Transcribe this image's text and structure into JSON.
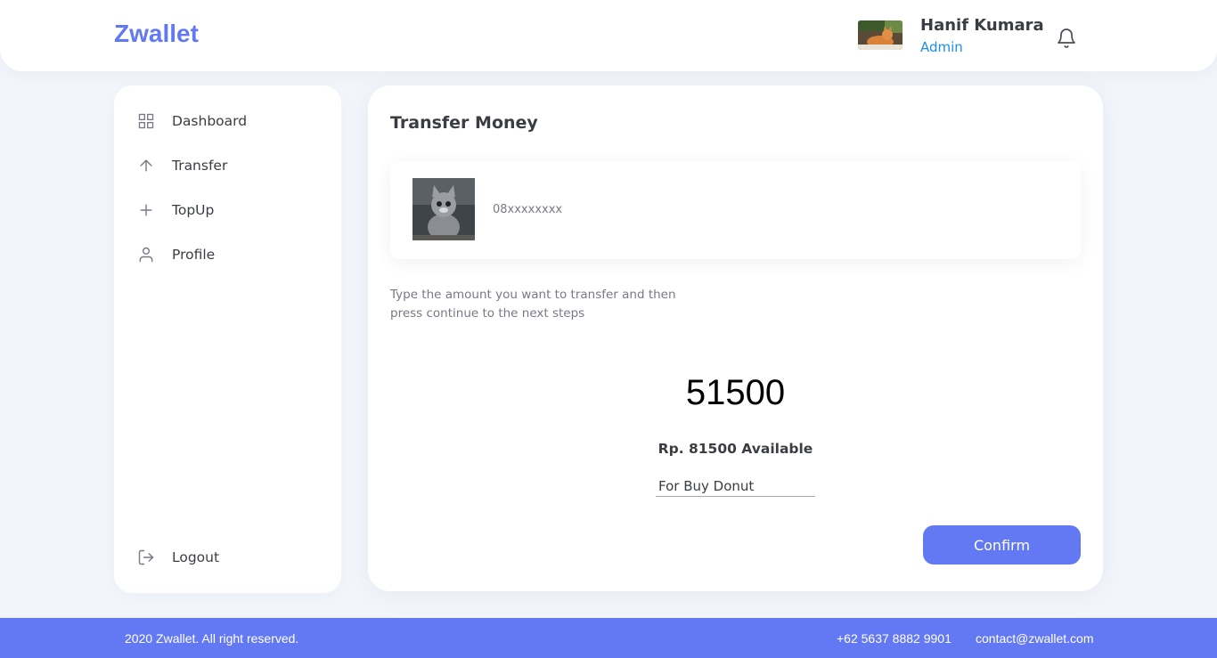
{
  "header": {
    "logo": "Zwallet",
    "user_name": "Hanif Kumara",
    "user_role": "Admin"
  },
  "sidebar": {
    "items": [
      {
        "label": "Dashboard",
        "icon": "grid-icon"
      },
      {
        "label": "Transfer",
        "icon": "arrow-up-icon"
      },
      {
        "label": "TopUp",
        "icon": "plus-icon"
      },
      {
        "label": "Profile",
        "icon": "user-icon"
      }
    ],
    "logout": {
      "label": "Logout",
      "icon": "logout-icon"
    }
  },
  "transfer": {
    "title": "Transfer Money",
    "receiver_phone": "08xxxxxxxx",
    "instructions": "Type the amount you want to transfer and then press continue to the next steps",
    "amount": "51500",
    "available": "Rp. 81500 Available",
    "note_value": "For Buy Donut",
    "confirm_label": "Confirm"
  },
  "footer": {
    "copyright": "2020 Zwallet. All right reserved.",
    "phone": "+62 5637 8882 9901",
    "email": "contact@zwallet.com"
  },
  "colors": {
    "accent": "#6379f4",
    "role": "#1b8fe8",
    "background": "#f3f5fd"
  }
}
